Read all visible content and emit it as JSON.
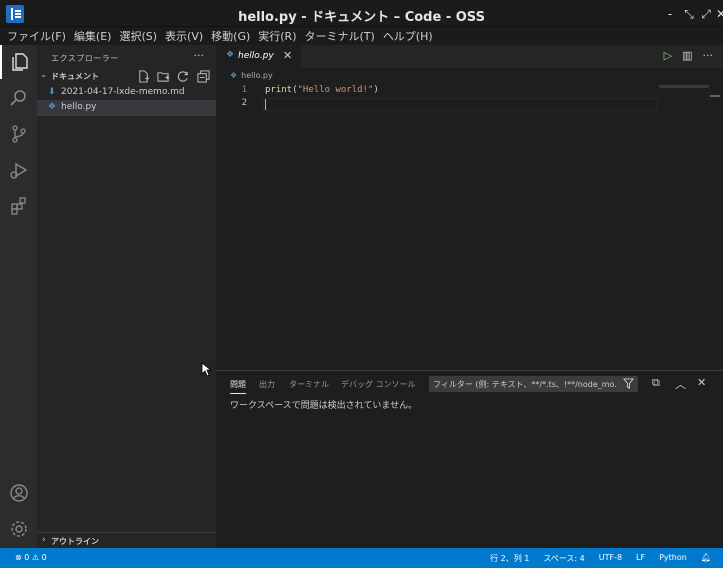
{
  "window": {
    "title": "hello.py - ドキュメント – Code - OSS",
    "controls": [
      "‐",
      "⤡",
      "⤢",
      "✕"
    ]
  },
  "menu": [
    "ファイル(F)",
    "編集(E)",
    "選択(S)",
    "表示(V)",
    "移動(G)",
    "実行(R)",
    "ターミナル(T)",
    "ヘルプ(H)"
  ],
  "activity_bar": [
    "explorer-icon",
    "search-icon",
    "source-control-icon",
    "run-debug-icon",
    "extensions-icon",
    "account-icon",
    "settings-gear-icon"
  ],
  "sidebar": {
    "title": "エクスプローラー",
    "more": "···",
    "folder": {
      "chevron": "›",
      "name": "ドキュメント"
    },
    "files": [
      {
        "name": "2021-04-17-lxde-memo.md",
        "icon": "markdown-icon",
        "icon_glyph": "⬇",
        "icon_color": "#519aba",
        "selected": false
      },
      {
        "name": "hello.py",
        "icon": "python-icon",
        "icon_glyph": "❖",
        "icon_color": "#519aba",
        "selected": true
      }
    ],
    "outline_chevron": "›",
    "outline": "アウトライン"
  },
  "editor": {
    "tab": {
      "icon": "❖",
      "label": "hello.py",
      "close": "✕"
    },
    "actions": {
      "run": "▷",
      "split": "▥",
      "more": "···"
    },
    "breadcrumb": {
      "icon": "❖",
      "label": "hello.py"
    },
    "lines": [
      {
        "number": "1",
        "fn": "print",
        "open": "(",
        "str": "\"Hello world!\"",
        "close": ")"
      },
      {
        "number": "2"
      }
    ]
  },
  "panel": {
    "tabs": [
      "問題",
      "出力",
      "ターミナル",
      "デバッグ コンソール"
    ],
    "active_tab": "問題",
    "filter_placeholder": "フィルター (例: テキスト、**/*.ts、!**/node_mo...",
    "actions": {
      "collapse": "⧉",
      "maximize": "︿",
      "close": "✕"
    },
    "message": "ワークスペースで問題は検出されていません。"
  },
  "statusbar": {
    "problems": "⊗ 0 ⚠ 0",
    "position": "行 2、列 1",
    "spaces": "スペース: 4",
    "encoding": "UTF-8",
    "eol": "LF",
    "language": "Python",
    "bell": "🔔︎"
  },
  "colors": {
    "accent": "#007acc",
    "sidebar_bg": "#252526",
    "editor_bg": "#1e1e1e",
    "python_icon": "#519aba"
  }
}
